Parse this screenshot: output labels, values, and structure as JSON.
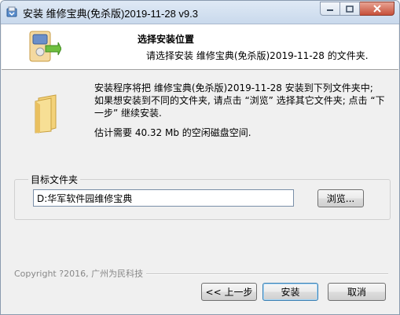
{
  "window": {
    "title": "安装 维修宝典(免杀版)2019-11-28 v9.3"
  },
  "header": {
    "title": "选择安装位置",
    "subtitle": "请选择安装 维修宝典(免杀版)2019-11-28 的文件夹."
  },
  "body": {
    "description": "安装程序将把 维修宝典(免杀版)2019-11-28 安装到下列文件夹中; 如果想安装到不同的文件夹, 请点击 “浏览” 选择其它文件夹; 点击 “下一步” 继续安装.",
    "space_required": "估计需要 40.32 Mb 的空闲磁盘空间."
  },
  "destination": {
    "group_label": "目标文件夹",
    "path_value": "D:华军软件园维修宝典",
    "browse_label": "浏览..."
  },
  "footer": {
    "copyright": "Copyright ?2016, 广州为民科技",
    "back_label": "<< 上一步",
    "install_label": "安装",
    "cancel_label": "取消"
  },
  "colors": {
    "close_button": "#c7503a",
    "titlebar": "#c9d9ec",
    "default_button_border": "#3c7fb1"
  }
}
